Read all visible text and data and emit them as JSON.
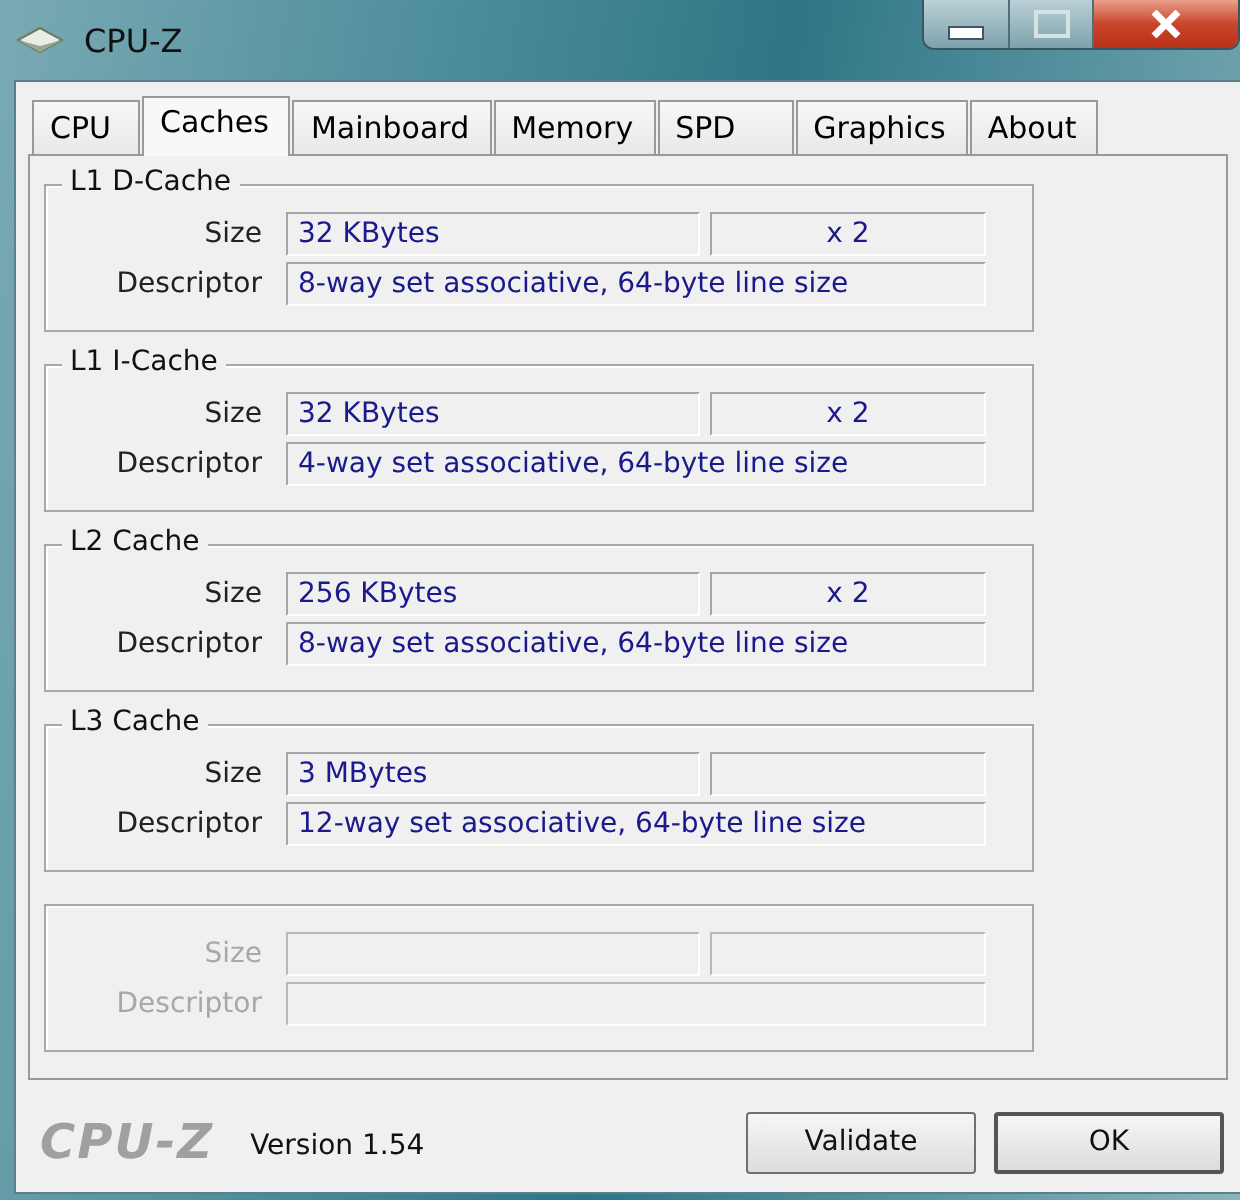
{
  "window": {
    "title": "CPU-Z"
  },
  "tabs": [
    {
      "label": "CPU",
      "selected": false
    },
    {
      "label": "Caches",
      "selected": true
    },
    {
      "label": "Mainboard",
      "selected": false
    },
    {
      "label": "Memory",
      "selected": false
    },
    {
      "label": "SPD",
      "selected": false
    },
    {
      "label": "Graphics",
      "selected": false
    },
    {
      "label": "About",
      "selected": false
    }
  ],
  "groups": [
    {
      "title": "L1 D-Cache",
      "disabled": false,
      "size_label": "Size",
      "size": "32 KBytes",
      "count": "x 2",
      "descriptor_label": "Descriptor",
      "descriptor": "8-way set associative, 64-byte line size"
    },
    {
      "title": "L1 I-Cache",
      "disabled": false,
      "size_label": "Size",
      "size": "32 KBytes",
      "count": "x 2",
      "descriptor_label": "Descriptor",
      "descriptor": "4-way set associative, 64-byte line size"
    },
    {
      "title": "L2 Cache",
      "disabled": false,
      "size_label": "Size",
      "size": "256 KBytes",
      "count": "x 2",
      "descriptor_label": "Descriptor",
      "descriptor": "8-way set associative, 64-byte line size"
    },
    {
      "title": "L3 Cache",
      "disabled": false,
      "size_label": "Size",
      "size": "3 MBytes",
      "descriptor_label": "Descriptor",
      "descriptor": "12-way set associative, 64-byte line size"
    },
    {
      "disabled": true,
      "size_label": "Size",
      "descriptor_label": "Descriptor"
    }
  ],
  "footer": {
    "logo": "CPU-Z",
    "version": "Version 1.54",
    "buttons": [
      "Validate",
      "OK"
    ]
  }
}
